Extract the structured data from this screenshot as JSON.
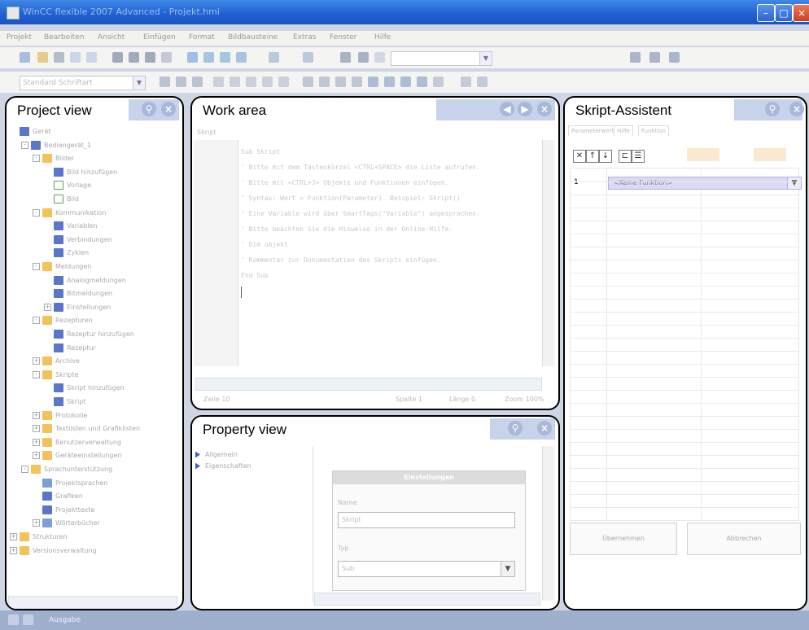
{
  "window": {
    "title": "WinCC flexible 2007 Advanced - Projekt.hmi"
  },
  "menu": [
    "Projekt",
    "Bearbeiten",
    "Ansicht",
    "Einfügen",
    "Format",
    "Bildbausteine",
    "Extras",
    "Fenster",
    "Hilfe"
  ],
  "toolbar": {
    "search_value": "",
    "font_combo": "Standard Schriftart"
  },
  "panels": {
    "project": {
      "title": "Project view",
      "tree": [
        {
          "label": "Gerät",
          "level": 0,
          "icon": "blue"
        },
        {
          "label": "Bediengerät_1",
          "level": 1,
          "icon": "blue",
          "exp": "-"
        },
        {
          "label": "Bilder",
          "level": 2,
          "icon": "folder",
          "exp": "-"
        },
        {
          "label": "Bild hinzufügen",
          "level": 3,
          "icon": "blue"
        },
        {
          "label": "Vorlage",
          "level": 3,
          "icon": "screen"
        },
        {
          "label": "Bild",
          "level": 3,
          "icon": "screen"
        },
        {
          "label": "Kommunikation",
          "level": 2,
          "icon": "folder",
          "exp": "-"
        },
        {
          "label": "Variablen",
          "level": 3,
          "icon": "blue"
        },
        {
          "label": "Verbindungen",
          "level": 3,
          "icon": "blue"
        },
        {
          "label": "Zyklen",
          "level": 3,
          "icon": "blue"
        },
        {
          "label": "Meldungen",
          "level": 2,
          "icon": "folder",
          "exp": "-"
        },
        {
          "label": "Analogmeldungen",
          "level": 3,
          "icon": "blue"
        },
        {
          "label": "Bitmeldungen",
          "level": 3,
          "icon": "blue"
        },
        {
          "label": "Einstellungen",
          "level": 3,
          "icon": "blue",
          "exp": "+"
        },
        {
          "label": "Rezepturen",
          "level": 2,
          "icon": "folder",
          "exp": "-"
        },
        {
          "label": "Rezeptur hinzufügen",
          "level": 3,
          "icon": "blue"
        },
        {
          "label": "Rezeptur",
          "level": 3,
          "icon": "blue"
        },
        {
          "label": "Archive",
          "level": 2,
          "icon": "folder",
          "exp": "+"
        },
        {
          "label": "Skripte",
          "level": 2,
          "icon": "folder",
          "exp": "-"
        },
        {
          "label": "Skript hinzufügen",
          "level": 3,
          "icon": "blue"
        },
        {
          "label": "Skript",
          "level": 3,
          "icon": "blue"
        },
        {
          "label": "Protokolle",
          "level": 2,
          "icon": "folder",
          "exp": "+"
        },
        {
          "label": "Textlisten und Grafiklisten",
          "level": 2,
          "icon": "folder",
          "exp": "+"
        },
        {
          "label": "Benutzerverwaltung",
          "level": 2,
          "icon": "folder",
          "exp": "+"
        },
        {
          "label": "Geräteeinstellungen",
          "level": 2,
          "icon": "folder",
          "exp": "+"
        },
        {
          "label": "Sprachunterstützung",
          "level": 1,
          "icon": "folder",
          "exp": "-"
        },
        {
          "label": "Projektsprachen",
          "level": 2,
          "icon": "gear"
        },
        {
          "label": "Grafiken",
          "level": 2,
          "icon": "blue"
        },
        {
          "label": "Projekttexte",
          "level": 2,
          "icon": "blue"
        },
        {
          "label": "Wörterbücher",
          "level": 2,
          "icon": "gear",
          "exp": "+"
        },
        {
          "label": "Strukturen",
          "level": 0,
          "icon": "folder",
          "exp": "+"
        },
        {
          "label": "Versionsverwaltung",
          "level": 0,
          "icon": "folder",
          "exp": "+"
        }
      ]
    },
    "work": {
      "title": "Work area",
      "tab": "Skript",
      "code": [
        "Sub Skript",
        "' Bitte mit dem Tastenkürzel <CTRL+SPACE> die Liste aufrufen.",
        "' Bitte mit <CTRL+J> Objekte und Funktionen einfügen.",
        "' Syntax: Wert = Funktion(Parameter). Beispiel: Skript()",
        "' Eine Variable wird über SmartTags(\"Variable\") angesprochen.",
        "' Bitte beachten Sie die Hinweise in der Online-Hilfe.",
        "' Dim objekt",
        "' Kommentar zur Dokumentation des Skripts einfügen.",
        "End Sub"
      ],
      "status": [
        "Zeile 10",
        "Spalte 1",
        "Länge 0",
        "Zoom 100%"
      ]
    },
    "property": {
      "title": "Property view",
      "items": [
        "Allgemein",
        "Eigenschaften"
      ],
      "group_title": "Einstellungen",
      "name_label": "Name",
      "name_value": "Skript",
      "type_label": "Typ",
      "type_value": "Sub"
    },
    "skript": {
      "title": "Skript-Assistent",
      "tabs": [
        "Parameterwerte",
        "Hilfe",
        "Funktion"
      ],
      "row_number": "1",
      "select_text": "<Keine Funktion>",
      "left_button": "Übernehmen",
      "right_button": "Abbrechen"
    }
  },
  "taskbar": {
    "item": "Ausgabe"
  }
}
